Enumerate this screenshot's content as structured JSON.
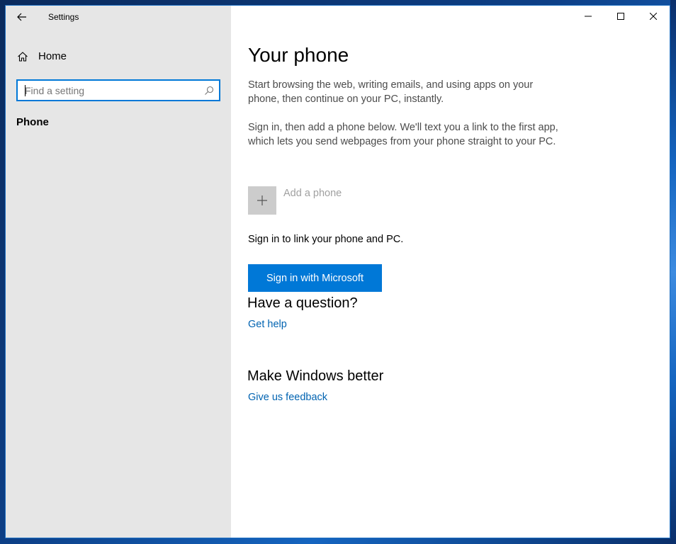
{
  "window": {
    "title": "Settings",
    "controls": {
      "minimize_icon": "minimize-icon",
      "maximize_icon": "maximize-icon",
      "close_icon": "close-icon"
    }
  },
  "sidebar": {
    "back_icon": "back-arrow-icon",
    "home": {
      "label": "Home",
      "icon": "home-icon"
    },
    "search": {
      "placeholder": "Find a setting",
      "value": "",
      "icon": "search-icon"
    },
    "items": [
      {
        "label": "Phone",
        "selected": true
      }
    ]
  },
  "main": {
    "title": "Your phone",
    "paragraphs": [
      "Start browsing the web, writing emails, and using apps on your phone, then continue on your PC, instantly.",
      "Sign in, then add a phone below. We'll text you a link to the first app, which lets you send webpages from your phone straight to your PC."
    ],
    "add_phone": {
      "label": "Add a phone",
      "icon": "plus-icon",
      "enabled": false
    },
    "signin_text": "Sign in to link your phone and PC.",
    "signin_button": "Sign in with Microsoft",
    "question": {
      "heading": "Have a question?",
      "link": "Get help"
    },
    "better": {
      "heading": "Make Windows better",
      "link": "Give us feedback"
    }
  },
  "colors": {
    "accent": "#0078d7",
    "link": "#0063b1",
    "sidebar_bg": "#e6e6e6",
    "disabled_tile": "#cccccc",
    "disabled_text": "#a0a0a0"
  }
}
